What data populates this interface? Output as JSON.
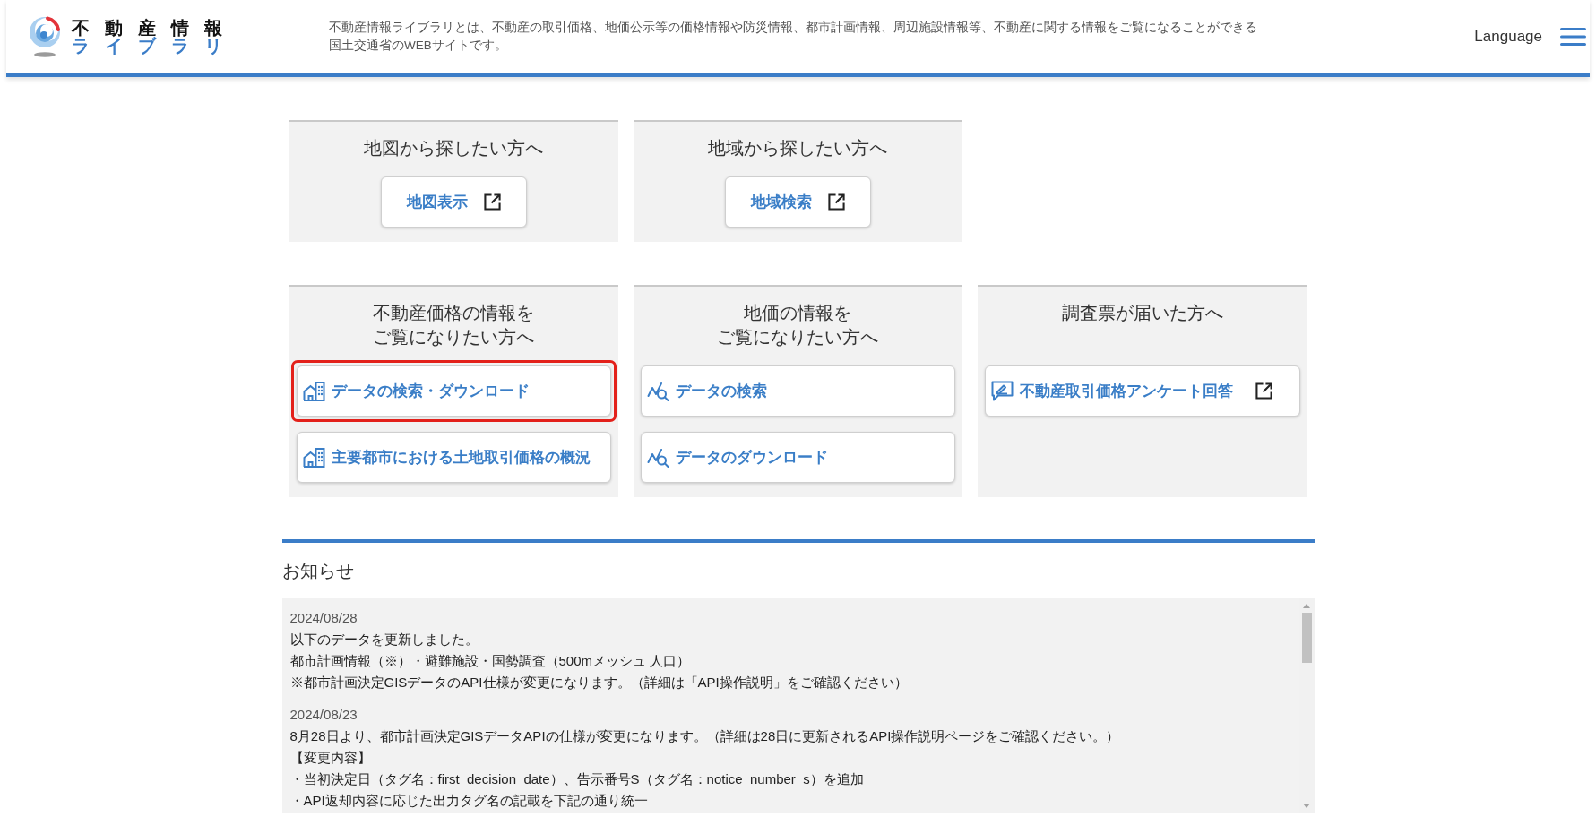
{
  "header": {
    "logo": {
      "title_top": "不動産情報",
      "title_bottom": "ライブラリ"
    },
    "description_lines": [
      "不動産情報ライブラリとは、不動産の取引価格、地価公示等の価格情報や防災情報、都市計画情報、周辺施設情報等、不動産に関する情報をご覧になることができる",
      "国土交通省のWEBサイトです。"
    ],
    "language_link": "Language"
  },
  "panel_rows": [
    {
      "panels": [
        {
          "title_lines": [
            "地図から探したい方へ"
          ],
          "buttons": [
            {
              "kind": "compact",
              "label": "地図表示",
              "external": true,
              "highlighted": false
            }
          ]
        },
        {
          "title_lines": [
            "地域から探したい方へ"
          ],
          "buttons": [
            {
              "kind": "compact",
              "label": "地域検索",
              "external": true,
              "highlighted": false
            }
          ]
        }
      ]
    },
    {
      "panels": [
        {
          "title_lines": [
            "不動産価格の情報を",
            "ご覧になりたい方へ"
          ],
          "buttons": [
            {
              "kind": "wide",
              "label": "データの検索・ダウンロード",
              "external": false,
              "highlighted": true
            },
            {
              "kind": "wide",
              "label": "主要都市における土地取引価格の概況",
              "external": false,
              "highlighted": false
            }
          ]
        },
        {
          "title_lines": [
            "地価の情報を",
            "ご覧になりたい方へ"
          ],
          "buttons": [
            {
              "kind": "wide",
              "label": "データの検索",
              "external": false,
              "highlighted": false
            },
            {
              "kind": "wide",
              "label": "データのダウンロード",
              "external": false,
              "highlighted": false
            }
          ]
        },
        {
          "title_lines": [
            "調査票が届いた方へ"
          ],
          "buttons": [
            {
              "kind": "wide",
              "label": "不動産取引価格アンケート回答",
              "external": true,
              "highlighted": false
            }
          ]
        }
      ]
    }
  ],
  "notices": {
    "heading": "お知らせ",
    "items": [
      {
        "date": "2024/08/28",
        "lines": [
          "以下のデータを更新しました。",
          "都市計画情報（※）・避難施設・国勢調査（500mメッシュ 人口）",
          "※都市計画決定GISデータのAPI仕様が変更になります。（詳細は「API操作説明」をご確認ください）"
        ]
      },
      {
        "date": "2024/08/23",
        "lines": [
          "8月28日より、都市計画決定GISデータAPIの仕様が変更になります。（詳細は28日に更新されるAPI操作説明ページをご確認ください。）",
          "【変更内容】",
          "・当初決定日（タグ名：first_decision_date）、告示番号S（タグ名：notice_number_s）を追加",
          "・API返却内容に応じた出力タグ名の記載を下記の通り統一"
        ]
      }
    ]
  }
}
